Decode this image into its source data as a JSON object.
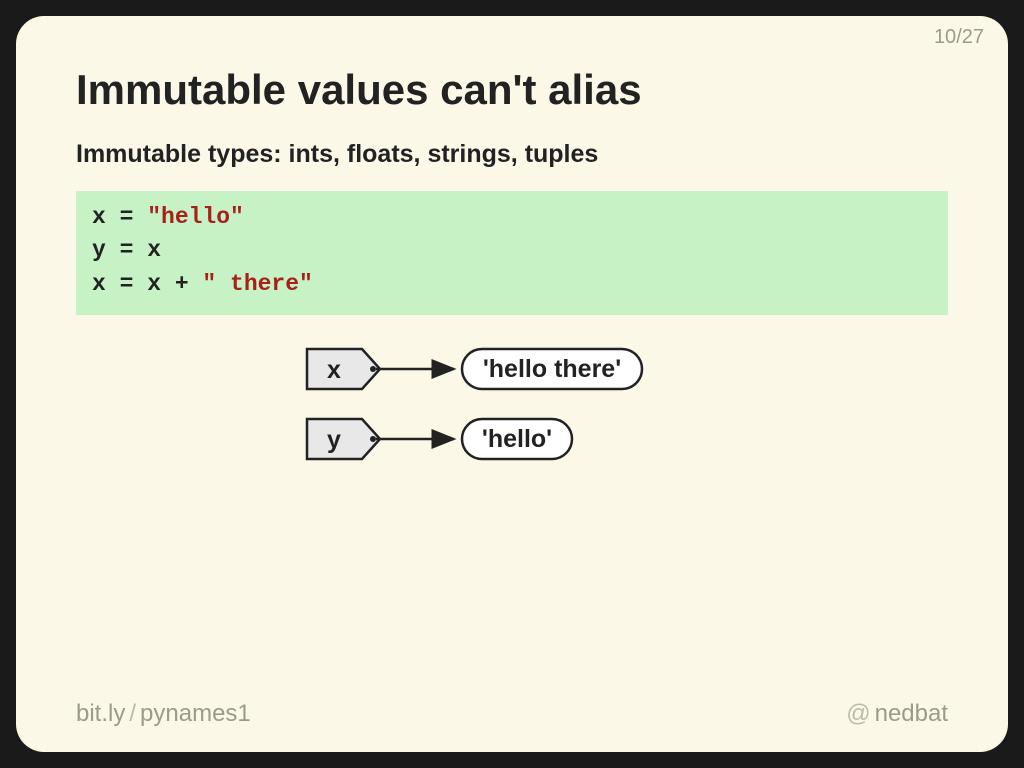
{
  "page": {
    "current": "10",
    "total": "27",
    "sep": "/"
  },
  "title": "Immutable values can't alias",
  "subtitle": "Immutable types: ints, floats, strings, tuples",
  "code": {
    "l1a": "x = ",
    "l1b": "\"hello\"",
    "l2": "y = x",
    "l3a": "x = x + ",
    "l3b": "\" there\""
  },
  "diagram": {
    "var_x": "x",
    "var_y": "y",
    "val_x": "'hello there'",
    "val_y": "'hello'"
  },
  "footer": {
    "domain": "bit.ly",
    "slash": "/",
    "path": "pynames1",
    "at": "@",
    "handle": "nedbat"
  }
}
